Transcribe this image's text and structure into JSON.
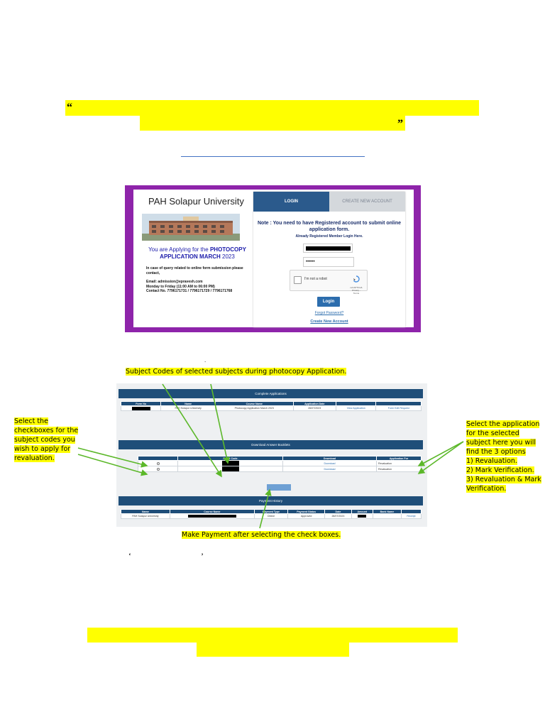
{
  "quotes": {
    "open": "“",
    "close": "”"
  },
  "login": {
    "university": "PAH Solapur University",
    "applying_prefix": "You are Applying for the ",
    "applying_bold": "PHOTOCOPY APPLICATION MARCH",
    "applying_year": " 2023",
    "contact_intro": "In case of query related to online form submission please contact,",
    "email": "Email: admission@epravesh.com",
    "hours": "Monday to Friday (11:00 AM to 06:00 PM)",
    "phone": "Contact No. 7796171731 / 7796171729 / 7796171768",
    "tab_login": "LOGIN",
    "tab_create": "CREATE NEW ACCOUNT",
    "note": "Note : You need to have Registered account to submit online application form.",
    "already": "Already Registered Member Login Here.",
    "password_mask": "••••••",
    "captcha_label": "I'm not a robot",
    "captcha_brand": "reCAPTCHA",
    "captcha_terms": "Privacy - Terms",
    "login_button": "Login",
    "forgot": "Forgot Password?",
    "create_account": "Create New Account"
  },
  "annotations": {
    "subject_codes": "Subject Codes of selected subjects during photocopy Application.",
    "checkbox_note": [
      "Select the",
      "checkboxes for the",
      "subject codes you",
      "wish to apply for",
      "revaluation."
    ],
    "application_note": [
      "Select the application",
      "for the selected",
      "subject here you will",
      "find the 3 options",
      "1) Revaluation.",
      "2) Mark Verification.",
      "3) Revaluation & Mark",
      "Verification."
    ],
    "payment_note": "Make Payment after selecting the check boxes.",
    "single_quotes": {
      "open": "‘",
      "close": "’"
    },
    "dot": "."
  },
  "applications": {
    "complete_title": "Complete Applications",
    "complete_headers": [
      "Form No",
      "Name",
      "Course Name",
      "Application Date",
      "",
      ""
    ],
    "complete_row": {
      "name": "PAH Solapur University",
      "course": "Photocopy Application March 2023",
      "date": "26/07/2023",
      "view": "View Application",
      "edit": "Form Edit Request"
    },
    "download_title": "Download Answer Booklets",
    "download_headers": [
      "",
      "Paper Code",
      "Download",
      "Application For"
    ],
    "download_rows": [
      {
        "download": "Download",
        "application_for": "Revaluation"
      },
      {
        "download": "Download",
        "application_for": "Revaluation"
      }
    ],
    "payment_title": "Payment History",
    "payment_headers": [
      "Name",
      "Course Name",
      "Payment Type",
      "Payment Status",
      "Date",
      "Amount",
      "Bank Name",
      ""
    ],
    "payment_row": {
      "name": "PAH Solapur University",
      "type": "Online",
      "status": "Approved",
      "date": "26/07/2023",
      "receipt": "Receipt"
    }
  }
}
